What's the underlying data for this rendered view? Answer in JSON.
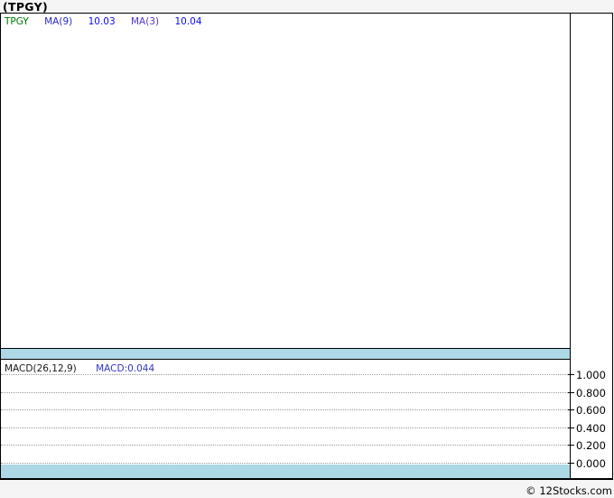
{
  "page": {
    "title": "(TPGY)",
    "copyright": "© 12Stocks.com"
  },
  "main_panel": {
    "legend": {
      "ticker": "TPGY",
      "ma9_label": "MA(9)",
      "ma9_value": "10.03",
      "ma3_label": "MA(3)",
      "ma3_value": "10.04"
    }
  },
  "macd_panel": {
    "legend_label": "MACD(26,12,9)",
    "legend_value": "MACD:0.044",
    "axis_ticks": [
      "1.000",
      "0.800",
      "0.600",
      "0.400",
      "0.200",
      "0.000"
    ]
  },
  "colors": {
    "ticker_green": "#007700",
    "ma9_blue": "#2929cc",
    "value_blue": "#0b0bee",
    "ma3_purple": "#5533cc",
    "macd_value_blue": "#3333cc",
    "band_lightblue": "#add8e6"
  },
  "chart_data": [
    {
      "type": "line",
      "title": "(TPGY) price panel",
      "series": [
        {
          "name": "TPGY",
          "values": []
        },
        {
          "name": "MA(9)",
          "last_value": 10.03,
          "values": []
        },
        {
          "name": "MA(3)",
          "last_value": 10.04,
          "values": []
        }
      ],
      "note": "plot area is empty/flat in the screenshot; a solid light-blue flat volume strip spans the bottom of the panel",
      "grid": "off",
      "legend_position": "top-left"
    },
    {
      "type": "line",
      "title": "MACD(26,12,9)",
      "series": [
        {
          "name": "MACD",
          "last_value": 0.044,
          "values": []
        }
      ],
      "ylim": [
        0.0,
        1.0
      ],
      "ytick_values": [
        1.0,
        0.8,
        0.6,
        0.4,
        0.2,
        0.0
      ],
      "ytick_labels": [
        "1.000",
        "0.800",
        "0.600",
        "0.400",
        "0.200",
        "0.000"
      ],
      "yaxis_position": "right",
      "grid": "dotted horizontal",
      "note": "no visible MACD line; solid light-blue flat strip spans the bottom of the panel",
      "legend_position": "top-left"
    }
  ]
}
